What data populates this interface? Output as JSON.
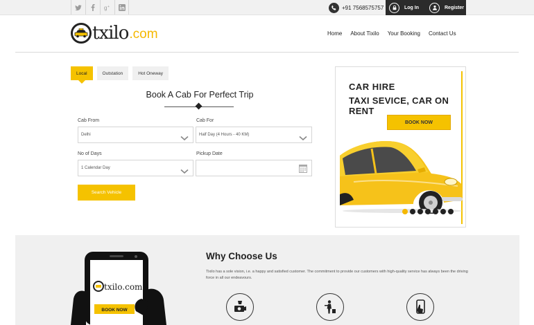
{
  "topbar": {
    "social": [
      {
        "icon": "twitter-icon",
        "glyph": "t"
      },
      {
        "icon": "facebook-icon",
        "glyph": "f"
      },
      {
        "icon": "google-plus-icon",
        "glyph": "g+"
      },
      {
        "icon": "linkedin-icon",
        "glyph": "in"
      }
    ],
    "phone": "+91 7568575757",
    "login_label": "Log In",
    "register_label": "Register"
  },
  "header": {
    "logo_main": "txilo",
    "logo_domain": ".com",
    "nav": [
      "Home",
      "About Tixilo",
      "Your Booking",
      "Contact Us"
    ]
  },
  "booking": {
    "tabs": [
      "Local",
      "Outstation",
      "Hot Oneway"
    ],
    "active_tab": "Local",
    "title": "Book A Cab For Perfect Trip",
    "cab_from_label": "Cab From",
    "cab_from_value": "Delhi",
    "cab_for_label": "Cab For",
    "cab_for_value": "Half Day (4 Hours - 40 KM)",
    "days_label": "No of Days",
    "days_value": "1 Calendar Day",
    "pickup_label": "Pickup Date",
    "pickup_value": "",
    "search_label": "Search Vehicle"
  },
  "ad": {
    "line1": "CAR HIRE",
    "line2": "TAXI SEVICE, CAR ON RENT",
    "button": "BOOK NOW",
    "slides": 7,
    "active_slide": 1
  },
  "why": {
    "title": "Why Choose Us",
    "text": "Tixilo has a sole vision, i.e. a happy and satisfied customer. The commitment to provide our customers with high-quality service has always been the driving force in all our endeavours.",
    "phone_logo": "txilo.com",
    "phone_button": "BOOK NOW"
  },
  "colors": {
    "accent": "#f5c200",
    "dark": "#2b2b2b"
  }
}
